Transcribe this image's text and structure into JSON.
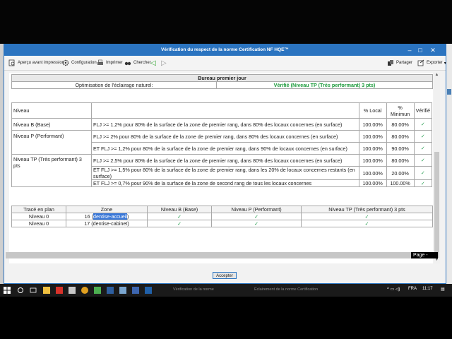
{
  "window": {
    "title": "Vérification du respect de la norme Certification NF HQE™",
    "min": "–",
    "max": "□",
    "close": "✕"
  },
  "toolbar": {
    "preview": "Aperçu avant impression",
    "config": "Configuration",
    "print": "Imprimer",
    "search": "Chercher",
    "back": "◁",
    "forward": "▷",
    "share": "Partager",
    "export": "Exporter",
    "export_arrow": "▾"
  },
  "report": {
    "title": "Bureau premier jour",
    "criterion": "Optimisation de l'éclairage naturel:",
    "result": "Vérifié (Niveau TP (Très performant) 3 pts)",
    "columns": {
      "niveau": "Niveau",
      "local": "% Local",
      "minimum": "% Minimun",
      "verifie": "Vérifié"
    },
    "levels": [
      {
        "name": "Niveau B (Base)",
        "rows": [
          {
            "text": "FLJ >= 1,2% pour 80% de la surface de la zone de premier rang, dans 80% des locaux concernes (en surface)",
            "local": "100.00%",
            "min": "80.00%",
            "check": "✓"
          }
        ]
      },
      {
        "name": "Niveau P (Performant)",
        "rows": [
          {
            "text": "FLJ >= 2% pour 80% de la surface de la zone de premier rang, dans 80% des locaux concernes (en surface)",
            "local": "100.00%",
            "min": "80.00%",
            "check": "✓"
          },
          {
            "text": "ET FLJ >= 1,2% pour 80% de la surface de la zone de premier rang, dans 90% de locaux concernes (en surface)",
            "local": "100.00%",
            "min": "90.00%",
            "check": "✓"
          }
        ]
      },
      {
        "name": "Niveau TP (Très performant) 3 pts",
        "rows": [
          {
            "text": "FLJ >= 2,5% pour 80% de la surface de la zone de premier rang, dans 80% des locaux concernes (en surface)",
            "local": "100.00%",
            "min": "80.00%",
            "check": "✓"
          },
          {
            "text": "ET FLJ >= 1,5% pour 80% de la surface de la zone de premier rang, dans les 20% de locaux concernes restants (en surface)",
            "local": "100.00%",
            "min": "20.00%",
            "check": "✓"
          },
          {
            "text": "ET FLJ >= 0,7% pour 90% de la surface de la zone de second rang de tous les locaux concernes",
            "local": "100.00%",
            "min": "100.00%",
            "check": "✓"
          }
        ]
      }
    ]
  },
  "zones": {
    "columns": [
      "Tracé en plan",
      "Zone",
      "Niveau B (Base)",
      "Niveau P (Performant)",
      "Niveau TP (Très performant) 3 pts"
    ],
    "rows": [
      {
        "plan": "Niveau 0",
        "zone_num": "16 (",
        "zone_name": "dentise-accueil",
        "zone_end": ")",
        "b": "✓",
        "p": "✓",
        "tp": "✓"
      },
      {
        "plan": "Niveau 0",
        "zone_num": "17 (",
        "zone_name": "dentise-cabinet",
        "zone_end": ")",
        "b": "✓",
        "p": "✓",
        "tp": "✓"
      }
    ]
  },
  "footer": {
    "page": "Page -",
    "accept": "Accepter"
  },
  "taskbar": {
    "item1": "Vérification de la norme",
    "item2": "Éclairement de la norme Certification",
    "lang": "FRA",
    "time": "11:17"
  },
  "colors": {
    "accent": "#2b74c0",
    "check": "#1f9a4a"
  }
}
